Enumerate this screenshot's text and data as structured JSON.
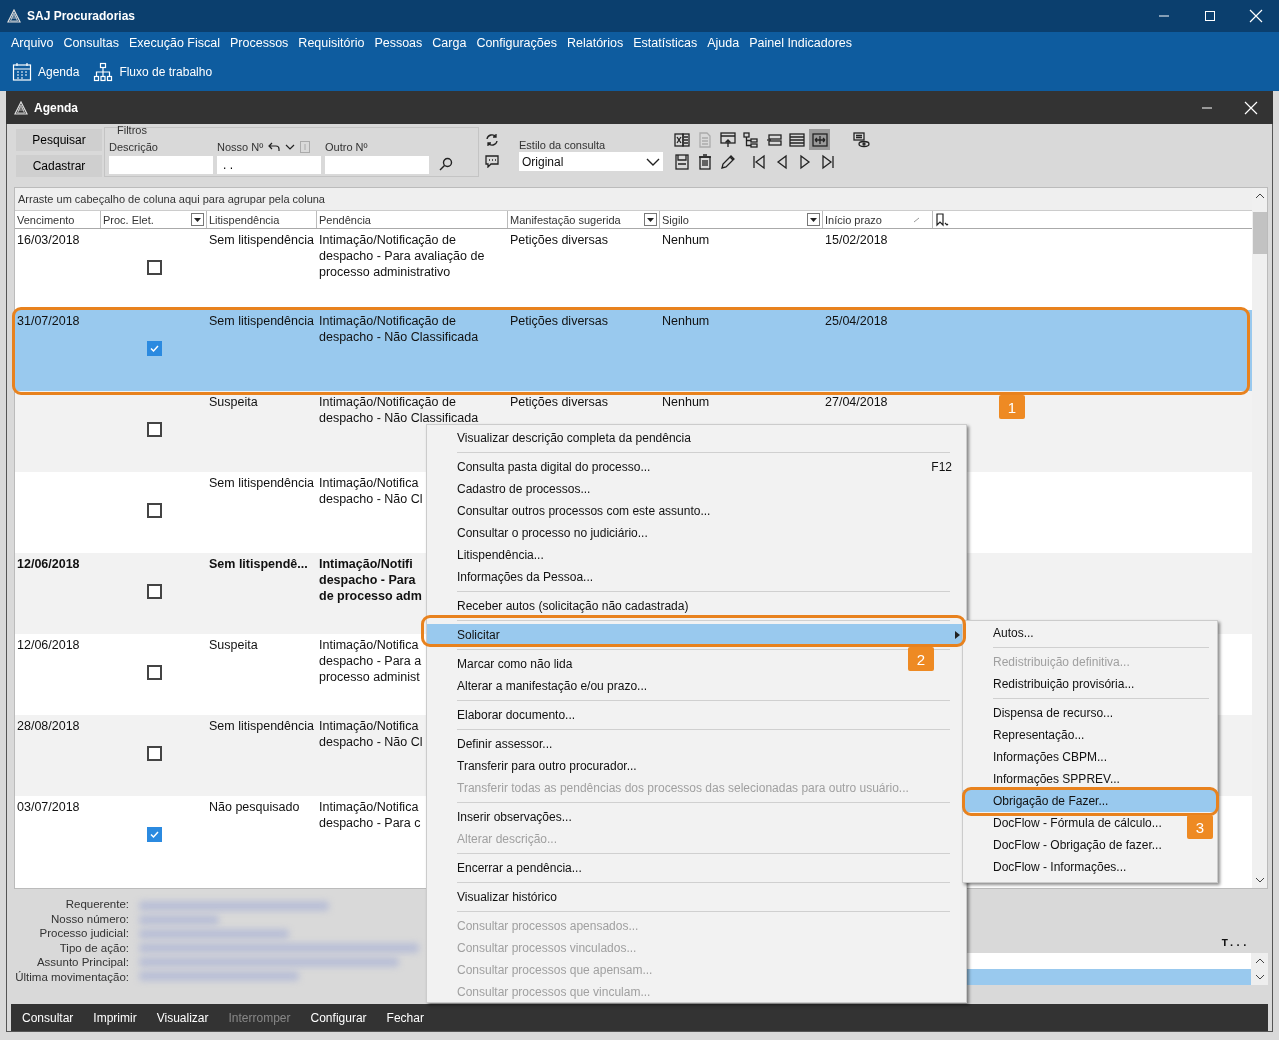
{
  "window": {
    "title": "SAJ Procuradorias"
  },
  "menu_bar": [
    "Arquivo",
    "Consultas",
    "Execução Fiscal",
    "Processos",
    "Requisitório",
    "Pessoas",
    "Carga",
    "Configurações",
    "Relatórios",
    "Estatísticas",
    "Ajuda",
    "Painel Indicadores"
  ],
  "toolbar": [
    {
      "kind": "calendar",
      "label": "Agenda"
    },
    {
      "kind": "flow",
      "label": "Fluxo de trabalho"
    }
  ],
  "agenda_window": {
    "title": "Agenda"
  },
  "filters": {
    "buttons": [
      "Pesquisar",
      "Cadastrar"
    ],
    "group_title": "Filtros",
    "fields": [
      {
        "label": "Descrição"
      },
      {
        "label": "Nosso Nº",
        "value": ". .",
        "tools": [
          {
            "kind": "undo",
            "disabled": false
          },
          {
            "kind": "dropdown",
            "disabled": false
          },
          {
            "kind": "note",
            "disabled": true
          }
        ]
      },
      {
        "label": "Outro Nº"
      }
    ]
  },
  "query_style": {
    "label": "Estilo da consulta",
    "value": "Original"
  },
  "grid_tools": [
    {
      "kind": "excel",
      "disabled": false,
      "selected": false
    },
    {
      "kind": "document",
      "disabled": true,
      "selected": false
    },
    {
      "kind": "import",
      "disabled": false,
      "selected": false
    },
    {
      "kind": "tree",
      "disabled": false,
      "selected": false
    },
    {
      "kind": "collapse",
      "disabled": false,
      "selected": false
    },
    {
      "kind": "lines",
      "disabled": false,
      "selected": false
    },
    {
      "kind": "fit",
      "disabled": false,
      "selected": true
    },
    {
      "kind": "preview",
      "disabled": false,
      "selected": false
    }
  ],
  "record_tools": [
    {
      "kind": "save",
      "disabled": false
    },
    {
      "kind": "delete",
      "disabled": false
    },
    {
      "kind": "edit",
      "disabled": false
    },
    {
      "kind": "first",
      "disabled": false
    },
    {
      "kind": "prev",
      "disabled": false
    },
    {
      "kind": "next",
      "disabled": false
    },
    {
      "kind": "last",
      "disabled": false
    }
  ],
  "grid": {
    "group_hint": "Arraste um cabeçalho de coluna aqui para agrupar pela coluna",
    "columns": [
      {
        "label": "Vencimento",
        "filter": false,
        "sorted": false
      },
      {
        "label": "Proc. Elet.",
        "filter": true,
        "sorted": false
      },
      {
        "label": "Litispendência",
        "filter": false,
        "sorted": false
      },
      {
        "label": "Pendência",
        "filter": false,
        "sorted": false
      },
      {
        "label": "Manifestação sugerida",
        "filter": true,
        "sorted": false
      },
      {
        "label": "Sigilo",
        "filter": true,
        "sorted": false
      },
      {
        "label": "Início prazo",
        "filter": false,
        "sorted": true
      }
    ],
    "rows": [
      {
        "vencimento": "16/03/2018",
        "proc_eletronico": false,
        "litispendencia": "Sem litispendência",
        "pendencia": "Intimação/Notificação de\ndespacho - Para avaliação de\nprocesso administrativo",
        "manifestacao": "Petições diversas",
        "sigilo": "Nenhum",
        "inicio_prazo": "15/02/2018",
        "selected": false,
        "unread": false
      },
      {
        "vencimento": "31/07/2018",
        "proc_eletronico": true,
        "litispendencia": "Sem litispendência",
        "pendencia": "Intimação/Notificação de\ndespacho - Não Classificada",
        "manifestacao": "Petições diversas",
        "sigilo": "Nenhum",
        "inicio_prazo": "25/04/2018",
        "selected": true,
        "unread": false
      },
      {
        "proc_eletronico": false,
        "litispendencia": "Suspeita",
        "pendencia": "Intimação/Notificação de\ndespacho - Não Classificada",
        "manifestacao": "Petições diversas",
        "sigilo": "Nenhum",
        "inicio_prazo": "27/04/2018",
        "selected": false,
        "unread": false
      },
      {
        "proc_eletronico": false,
        "litispendencia": "Sem litispendência",
        "pendencia": "Intimação/Notifica\ndespacho - Não Cl",
        "selected": false,
        "unread": false
      },
      {
        "vencimento": "12/06/2018",
        "proc_eletronico": false,
        "litispendencia": "Sem litispendê...",
        "pendencia": "Intimação/Notifi\ndespacho - Para\nde processo adm",
        "selected": false,
        "unread": true
      },
      {
        "vencimento": "12/06/2018",
        "proc_eletronico": false,
        "litispendencia": "Suspeita",
        "pendencia": "Intimação/Notifica\ndespacho - Para a\nprocesso administ",
        "selected": false,
        "unread": false
      },
      {
        "vencimento": "28/08/2018",
        "proc_eletronico": false,
        "litispendencia": "Sem litispendência",
        "pendencia": "Intimação/Notifica\ndespacho - Não Cl",
        "selected": false,
        "unread": false
      },
      {
        "vencimento": "03/07/2018",
        "proc_eletronico": true,
        "litispendencia": "Não pesquisado",
        "pendencia": "Intimação/Notifica\ndespacho - Para c",
        "selected": false,
        "unread": false
      }
    ]
  },
  "context_menu": {
    "items": [
      {
        "kind": "item",
        "label": "Visualizar descrição completa da pendência",
        "disabled": false,
        "selected": false,
        "submenu": false
      },
      {
        "kind": "separator"
      },
      {
        "kind": "item",
        "label": "Consulta pasta digital do processo...",
        "shortcut": "F12",
        "disabled": false,
        "selected": false,
        "submenu": false
      },
      {
        "kind": "item",
        "label": "Cadastro de processos...",
        "disabled": false,
        "selected": false,
        "submenu": false
      },
      {
        "kind": "item",
        "label": "Consultar outros processos com este assunto...",
        "disabled": false,
        "selected": false,
        "submenu": false
      },
      {
        "kind": "item",
        "label": "Consultar o processo no judiciário...",
        "disabled": false,
        "selected": false,
        "submenu": false
      },
      {
        "kind": "item",
        "label": "Litispendência...",
        "disabled": false,
        "selected": false,
        "submenu": false
      },
      {
        "kind": "item",
        "label": "Informações da Pessoa...",
        "disabled": false,
        "selected": false,
        "submenu": false
      },
      {
        "kind": "separator"
      },
      {
        "kind": "item",
        "label": "Receber autos (solicitação não cadastrada)",
        "disabled": false,
        "selected": false,
        "submenu": false
      },
      {
        "kind": "separator"
      },
      {
        "kind": "item",
        "label": "Solicitar",
        "disabled": false,
        "selected": true,
        "submenu": true
      },
      {
        "kind": "separator"
      },
      {
        "kind": "item",
        "label": "Marcar como não lida",
        "disabled": false,
        "selected": false,
        "submenu": false
      },
      {
        "kind": "item",
        "label": "Alterar a manifestação e/ou prazo...",
        "disabled": false,
        "selected": false,
        "submenu": false
      },
      {
        "kind": "separator"
      },
      {
        "kind": "item",
        "label": "Elaborar documento...",
        "disabled": false,
        "selected": false,
        "submenu": false
      },
      {
        "kind": "separator"
      },
      {
        "kind": "item",
        "label": "Definir assessor...",
        "disabled": false,
        "selected": false,
        "submenu": false
      },
      {
        "kind": "item",
        "label": "Transferir para outro procurador...",
        "disabled": false,
        "selected": false,
        "submenu": false
      },
      {
        "kind": "item",
        "label": "Transferir todas as pendências dos processos das selecionadas para outro usuário...",
        "disabled": true,
        "selected": false,
        "submenu": false
      },
      {
        "kind": "separator"
      },
      {
        "kind": "item",
        "label": "Inserir observações...",
        "disabled": false,
        "selected": false,
        "submenu": false
      },
      {
        "kind": "item",
        "label": "Alterar descrição...",
        "disabled": true,
        "selected": false,
        "submenu": false
      },
      {
        "kind": "separator"
      },
      {
        "kind": "item",
        "label": "Encerrar a pendência...",
        "disabled": false,
        "selected": false,
        "submenu": false
      },
      {
        "kind": "separator"
      },
      {
        "kind": "item",
        "label": "Visualizar histórico",
        "disabled": false,
        "selected": false,
        "submenu": false
      },
      {
        "kind": "separator"
      },
      {
        "kind": "item",
        "label": "Consultar processos apensados...",
        "disabled": true,
        "selected": false,
        "submenu": false
      },
      {
        "kind": "item",
        "label": "Consultar processos vinculados...",
        "disabled": true,
        "selected": false,
        "submenu": false
      },
      {
        "kind": "item",
        "label": "Consultar processos que apensam...",
        "disabled": true,
        "selected": false,
        "submenu": false
      },
      {
        "kind": "item",
        "label": "Consultar processos que vinculam...",
        "disabled": true,
        "selected": false,
        "submenu": false
      }
    ]
  },
  "submenu": {
    "items": [
      {
        "kind": "item",
        "label": "Autos...",
        "disabled": false,
        "selected": false
      },
      {
        "kind": "separator"
      },
      {
        "kind": "item",
        "label": "Redistribuição definitiva...",
        "disabled": true,
        "selected": false
      },
      {
        "kind": "item",
        "label": "Redistribuição provisória...",
        "disabled": false,
        "selected": false
      },
      {
        "kind": "separator"
      },
      {
        "kind": "item",
        "label": "Dispensa de recurso...",
        "disabled": false,
        "selected": false
      },
      {
        "kind": "item",
        "label": "Representação...",
        "disabled": false,
        "selected": false
      },
      {
        "kind": "item",
        "label": "Informações CBPM...",
        "disabled": false,
        "selected": false
      },
      {
        "kind": "item",
        "label": "Informações SPPREV...",
        "disabled": false,
        "selected": false
      },
      {
        "kind": "item",
        "label": "Obrigação de Fazer...",
        "disabled": false,
        "selected": true
      },
      {
        "kind": "item",
        "label": "DocFlow - Fórmula de cálculo...",
        "disabled": false,
        "selected": false
      },
      {
        "kind": "item",
        "label": "DocFlow - Obrigação de fazer...",
        "disabled": false,
        "selected": false
      },
      {
        "kind": "item",
        "label": "DocFlow - Informações...",
        "disabled": false,
        "selected": false
      }
    ]
  },
  "annotations": [
    {
      "label": "1"
    },
    {
      "label": "2"
    },
    {
      "label": "3"
    }
  ],
  "details": {
    "labels": [
      "Requerente:",
      "Nosso número:",
      "Processo judicial:",
      "Tipo de ação:",
      "Assunto Principal:",
      "Última movimentação:"
    ],
    "list_header": "T...",
    "list_rows": [
      {
        "selected": false
      },
      {
        "selected": true
      }
    ]
  },
  "action_bar": [
    {
      "label": "Consultar",
      "disabled": false
    },
    {
      "label": "Imprimir",
      "disabled": false
    },
    {
      "label": "Visualizar",
      "disabled": false
    },
    {
      "label": "Interromper",
      "disabled": true
    },
    {
      "label": "Configurar",
      "disabled": false
    },
    {
      "label": "Fechar",
      "disabled": false
    }
  ]
}
